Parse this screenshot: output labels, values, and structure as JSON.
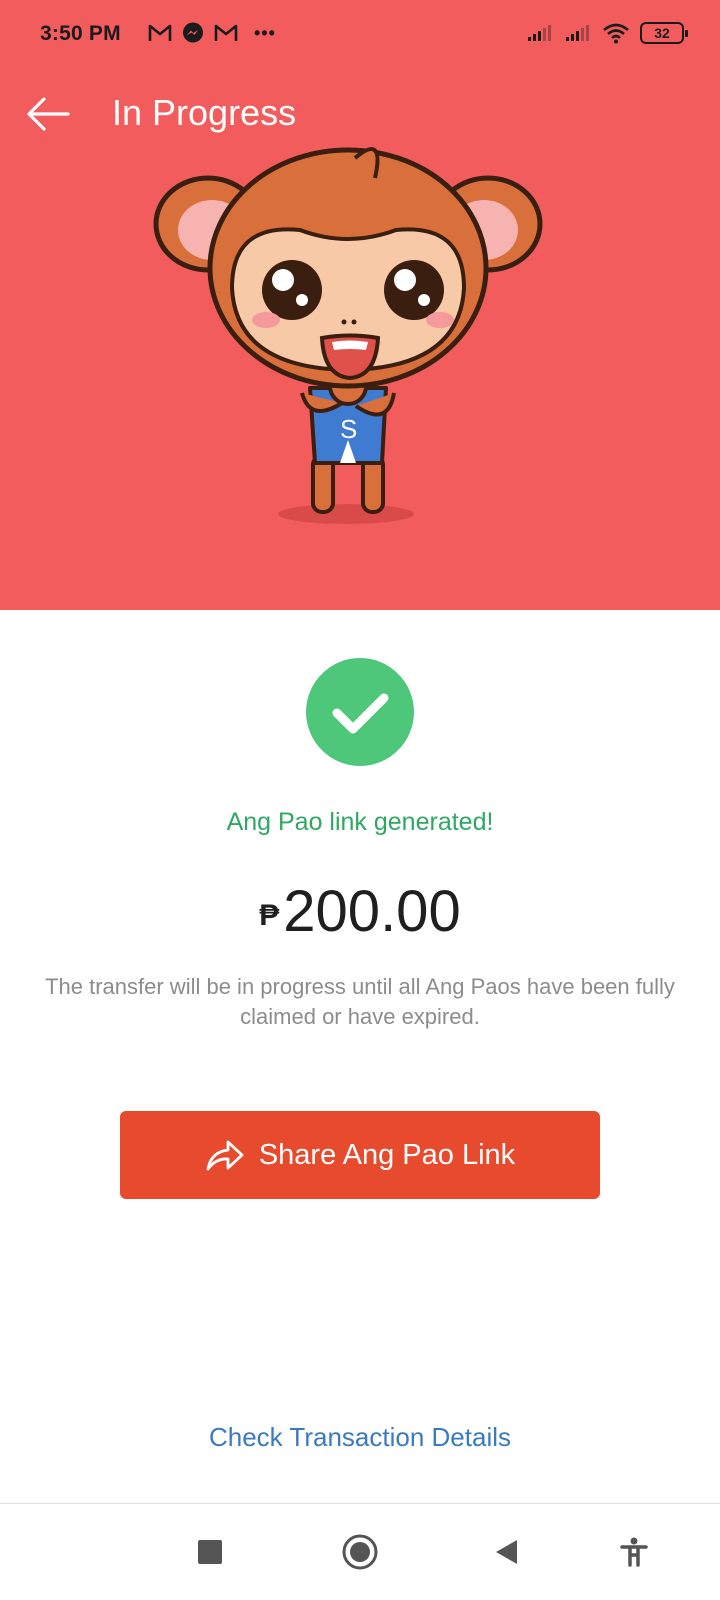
{
  "status_bar": {
    "time": "3:50 PM",
    "notification_icons": [
      "gmail-icon",
      "messenger-icon",
      "gmail-icon"
    ],
    "overflow": "•••",
    "battery": "32"
  },
  "toolbar": {
    "title": "In Progress",
    "back_icon": "arrow-left-icon"
  },
  "main": {
    "success_message": "Ang Pao link generated!",
    "currency_symbol": "₱",
    "amount": "200.00",
    "info": "The transfer will be in progress until all Ang Paos have been fully claimed or have expired.",
    "share_button_label": "Share Ang Pao Link",
    "transaction_link": "Check Transaction Details"
  },
  "colors": {
    "header": "#f25c5c",
    "success": "#4fc77a",
    "primary_button": "#e84a2e",
    "link": "#3a7bbf"
  }
}
